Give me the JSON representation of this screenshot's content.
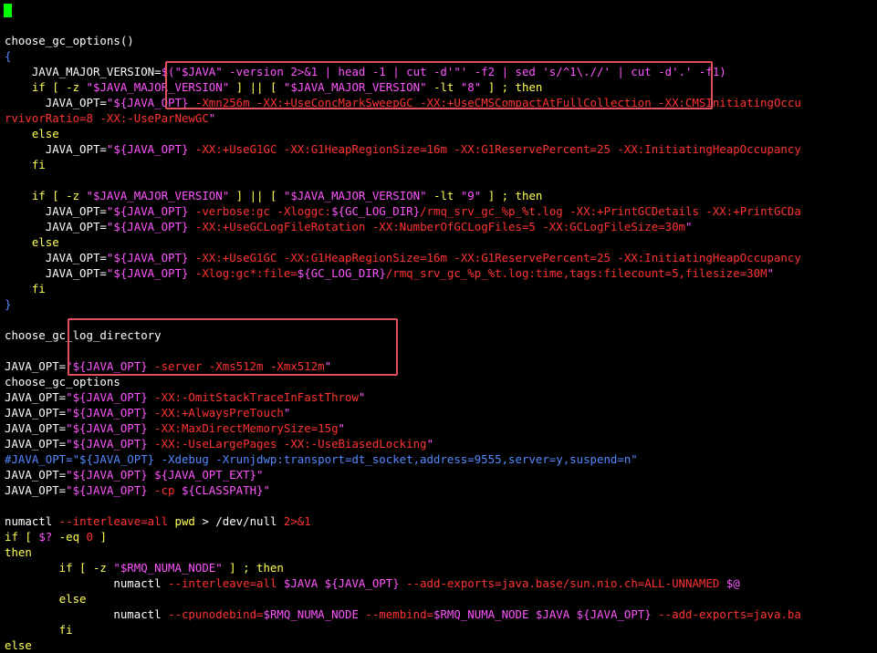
{
  "colors": {
    "w": "#ffffff",
    "y": "#ffff54",
    "m": "#ff55ff",
    "r": "#ff3333",
    "b": "#5588ff",
    "c": "#44dddd",
    "highlight": "#e0505e",
    "cursor": "#00ff00"
  },
  "lines": [
    [],
    [
      [
        "w",
        "choose_gc_options()"
      ]
    ],
    [
      [
        "b",
        "{"
      ]
    ],
    [
      [
        "w",
        "    JAVA_MAJOR_VERSION="
      ],
      [
        "m",
        "$(\"$JAVA\" -version 2>&1 | head -1 | cut -d'\"' -f2 | sed 's/^1\\.//' | cut -d'.' -f1)"
      ]
    ],
    [
      [
        "y",
        "    if [ -z "
      ],
      [
        "m",
        "\"$JAVA_MAJOR_VERSION\""
      ],
      [
        "y",
        " ] || [ "
      ],
      [
        "m",
        "\"$JAVA_MAJOR_VERSION\""
      ],
      [
        "y",
        " -lt "
      ],
      [
        "m",
        "\"8\""
      ],
      [
        "y",
        " ] ; then"
      ]
    ],
    [
      [
        "w",
        "      JAVA_OPT="
      ],
      [
        "m",
        "\"${JAVA_OPT} "
      ],
      [
        "r",
        "-Xmn256m -XX:+UseConcMarkSweepGC -XX:+UseCMSCompactAtFullCollection -XX:CMSInitiatingOccu"
      ]
    ],
    [
      [
        "r",
        "rvivorRatio=8 -XX:-UseParNewGC"
      ],
      [
        "m",
        "\""
      ]
    ],
    [
      [
        "y",
        "    else"
      ]
    ],
    [
      [
        "w",
        "      JAVA_OPT="
      ],
      [
        "m",
        "\"${JAVA_OPT} "
      ],
      [
        "r",
        "-XX:+UseG1GC -XX:G1HeapRegionSize=16m -XX:G1ReservePercent=25 -XX:InitiatingHeapOccupancy"
      ]
    ],
    [
      [
        "y",
        "    fi"
      ]
    ],
    [],
    [
      [
        "y",
        "    if [ -z "
      ],
      [
        "m",
        "\"$JAVA_MAJOR_VERSION\""
      ],
      [
        "y",
        " ] || [ "
      ],
      [
        "m",
        "\"$JAVA_MAJOR_VERSION\""
      ],
      [
        "y",
        " -lt "
      ],
      [
        "m",
        "\"9\""
      ],
      [
        "y",
        " ] ; then"
      ]
    ],
    [
      [
        "w",
        "      JAVA_OPT="
      ],
      [
        "m",
        "\"${JAVA_OPT} "
      ],
      [
        "r",
        "-verbose:gc -Xloggc:"
      ],
      [
        "m",
        "${GC_LOG_DIR}"
      ],
      [
        "r",
        "/rmq_srv_gc_%p_%t.log -XX:+PrintGCDetails -XX:+PrintGCDa"
      ]
    ],
    [
      [
        "w",
        "      JAVA_OPT="
      ],
      [
        "m",
        "\"${JAVA_OPT} "
      ],
      [
        "r",
        "-XX:+UseGCLogFileRotation -XX:NumberOfGCLogFiles=5 -XX:GCLogFileSize=30m"
      ],
      [
        "m",
        "\""
      ]
    ],
    [
      [
        "y",
        "    else"
      ]
    ],
    [
      [
        "w",
        "      JAVA_OPT="
      ],
      [
        "m",
        "\"${JAVA_OPT} "
      ],
      [
        "r",
        "-XX:+UseG1GC -XX:G1HeapRegionSize=16m -XX:G1ReservePercent=25 -XX:InitiatingHeapOccupancy"
      ]
    ],
    [
      [
        "w",
        "      JAVA_OPT="
      ],
      [
        "m",
        "\"${JAVA_OPT} "
      ],
      [
        "r",
        "-Xlog:gc*:file="
      ],
      [
        "m",
        "${GC_LOG_DIR}"
      ],
      [
        "r",
        "/rmq_srv_gc_%p_%t.log:time,tags:filecount=5,filesize=30M"
      ],
      [
        "m",
        "\""
      ]
    ],
    [
      [
        "y",
        "    fi"
      ]
    ],
    [
      [
        "b",
        "}"
      ]
    ],
    [],
    [
      [
        "w",
        "choose_gc_log_directory"
      ]
    ],
    [],
    [
      [
        "w",
        "JAVA_OPT="
      ],
      [
        "m",
        "\"${JAVA_OPT} "
      ],
      [
        "r",
        "-server -Xms512m -Xmx512m"
      ],
      [
        "m",
        "\""
      ]
    ],
    [
      [
        "w",
        "choose_gc_options"
      ]
    ],
    [
      [
        "w",
        "JAVA_OPT="
      ],
      [
        "m",
        "\"${JAVA_OPT} "
      ],
      [
        "r",
        "-XX:-OmitStackTraceInFastThrow"
      ],
      [
        "m",
        "\""
      ]
    ],
    [
      [
        "w",
        "JAVA_OPT="
      ],
      [
        "m",
        "\"${JAVA_OPT} "
      ],
      [
        "r",
        "-XX:+AlwaysPreTouch"
      ],
      [
        "m",
        "\""
      ]
    ],
    [
      [
        "w",
        "JAVA_OPT="
      ],
      [
        "m",
        "\"${JAVA_OPT} "
      ],
      [
        "r",
        "-XX:MaxDirectMemorySize=15g"
      ],
      [
        "m",
        "\""
      ]
    ],
    [
      [
        "w",
        "JAVA_OPT="
      ],
      [
        "m",
        "\"${JAVA_OPT} "
      ],
      [
        "r",
        "-XX:-UseLargePages -XX:-UseBiasedLocking"
      ],
      [
        "m",
        "\""
      ]
    ],
    [
      [
        "b",
        "#JAVA_OPT=\"${JAVA_OPT} -Xdebug -Xrunjdwp:transport=dt_socket,address=9555,server=y,suspend=n\""
      ]
    ],
    [
      [
        "w",
        "JAVA_OPT="
      ],
      [
        "m",
        "\"${JAVA_OPT} ${JAVA_OPT_EXT}\""
      ]
    ],
    [
      [
        "w",
        "JAVA_OPT="
      ],
      [
        "m",
        "\"${JAVA_OPT} "
      ],
      [
        "r",
        "-cp "
      ],
      [
        "m",
        "${CLASSPATH}\""
      ]
    ],
    [],
    [
      [
        "w",
        "numactl "
      ],
      [
        "r",
        "--interleave=all "
      ],
      [
        "y",
        "pwd"
      ],
      [
        "w",
        " > /dev/null "
      ],
      [
        "r",
        "2>&1"
      ]
    ],
    [
      [
        "y",
        "if [ "
      ],
      [
        "m",
        "$?"
      ],
      [
        "y",
        " -eq "
      ],
      [
        "r",
        "0"
      ],
      [
        "y",
        " ]"
      ]
    ],
    [
      [
        "y",
        "then"
      ]
    ],
    [
      [
        "y",
        "        if [ -z "
      ],
      [
        "m",
        "\"$RMQ_NUMA_NODE\""
      ],
      [
        "y",
        " ] ; then"
      ]
    ],
    [
      [
        "w",
        "                numactl "
      ],
      [
        "r",
        "--interleave=all "
      ],
      [
        "m",
        "$JAVA ${JAVA_OPT} "
      ],
      [
        "r",
        "--add-exports=java.base/sun.nio.ch=ALL-UNNAMED "
      ],
      [
        "m",
        "$@"
      ]
    ],
    [
      [
        "y",
        "        else"
      ]
    ],
    [
      [
        "w",
        "                numactl "
      ],
      [
        "r",
        "--cpunodebind="
      ],
      [
        "m",
        "$RMQ_NUMA_NODE "
      ],
      [
        "r",
        "--membind="
      ],
      [
        "m",
        "$RMQ_NUMA_NODE $JAVA ${JAVA_OPT} "
      ],
      [
        "r",
        "--add-exports=java.ba"
      ]
    ],
    [
      [
        "y",
        "        fi"
      ]
    ],
    [
      [
        "y",
        "else"
      ]
    ]
  ]
}
